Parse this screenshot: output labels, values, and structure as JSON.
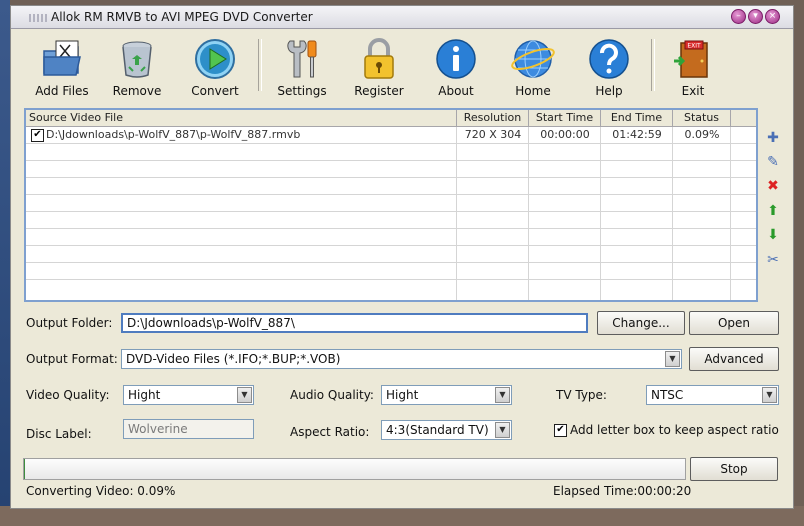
{
  "window": {
    "title": "Allok RM RMVB to AVI MPEG DVD Converter"
  },
  "toolbar": {
    "add_files": "Add Files",
    "remove": "Remove",
    "convert": "Convert",
    "settings": "Settings",
    "register": "Register",
    "about": "About",
    "home": "Home",
    "help": "Help",
    "exit": "Exit"
  },
  "file_list": {
    "columns": [
      "Source Video File",
      "Resolution",
      "Start Time",
      "End Time",
      "Status"
    ],
    "rows": [
      {
        "checked": true,
        "file": "D:\\Jdownloads\\p-WolfV_887\\p-WolfV_887.rmvb",
        "resolution": "720 X 304",
        "start": "00:00:00",
        "end": "01:42:59",
        "status": "0.09%"
      }
    ]
  },
  "side_icons": [
    "add-file-icon",
    "edit-icon",
    "delete-icon",
    "move-up-icon",
    "move-down-icon",
    "clear-icon"
  ],
  "output": {
    "folder_label": "Output Folder:",
    "folder_value": "D:\\Jdownloads\\p-WolfV_887\\",
    "change_label": "Change...",
    "open_label": "Open",
    "format_label": "Output Format:",
    "format_value": "DVD-Video Files  (*.IFO;*.BUP;*.VOB)",
    "advanced_label": "Advanced"
  },
  "options": {
    "video_quality_label": "Video Quality:",
    "video_quality_value": "Hight",
    "audio_quality_label": "Audio Quality:",
    "audio_quality_value": "Hight",
    "tv_type_label": "TV Type:",
    "tv_type_value": "NTSC",
    "disc_label_label": "Disc Label:",
    "disc_label_value": "Wolverine",
    "aspect_ratio_label": "Aspect Ratio:",
    "aspect_ratio_value": "4:3(Standard TV)",
    "letterbox_label": "Add letter box to keep aspect ratio",
    "letterbox_checked": true
  },
  "status": {
    "progress_fraction": 0.0009,
    "stop_label": "Stop",
    "converting_text": "Converting Video: 0.09%",
    "elapsed_text": "Elapsed Time:00:00:20"
  },
  "colors": {
    "accent_border": "#7fa0cf",
    "window_bg": "#ece9d8",
    "title_button": "#9b2b83"
  }
}
